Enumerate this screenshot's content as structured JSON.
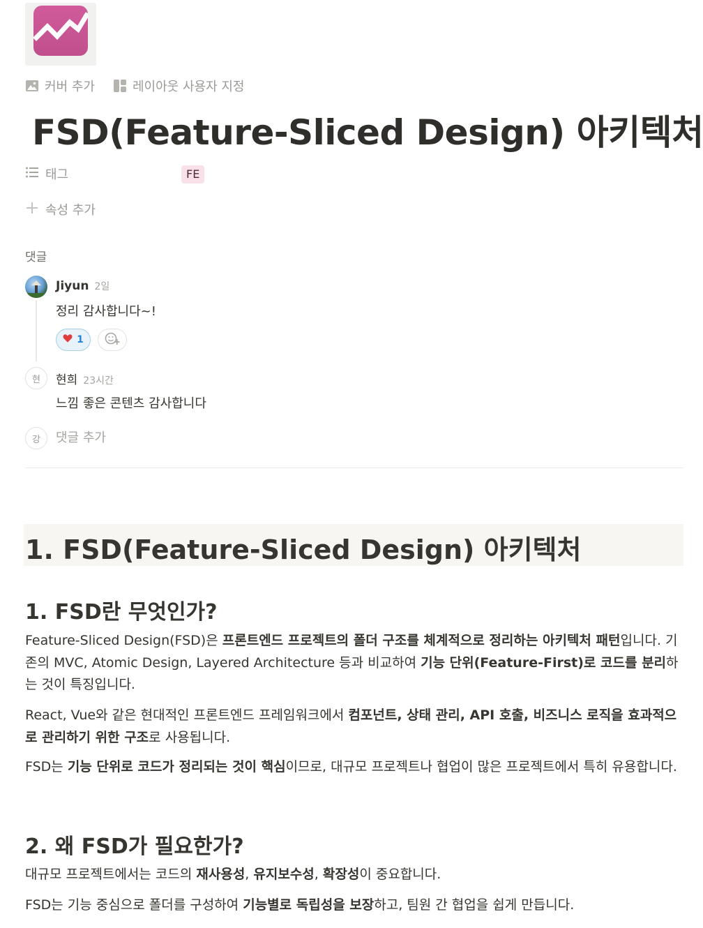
{
  "page": {
    "title": "FSD(Feature-Sliced Design) 아키텍처",
    "icon": "trending-chart-icon",
    "icon_color": "#c9559a"
  },
  "header_actions": {
    "add_cover": "커버 추가",
    "customize_layout": "레이아웃 사용자 지정"
  },
  "properties": {
    "tags_label": "태그",
    "tag_value": "FE",
    "tag_color": "#f9e1ea",
    "add_property": "속성 추가"
  },
  "comments": {
    "label": "댓글",
    "items": [
      {
        "author": "Jiyun",
        "time": "2일",
        "text": "정리 감사합니다~!",
        "reaction_count": "1"
      },
      {
        "avatar_initial": "현",
        "author": "현희",
        "time": "23시간",
        "text": "느낌 좋은 콘텐츠 감사합니다"
      }
    ],
    "composer_avatar": "강",
    "composer_placeholder": "댓글 추가"
  },
  "content": {
    "h1": "1. FSD(Feature-Sliced Design) 아키텍처",
    "section1": {
      "heading": "1. FSD란 무엇인가?",
      "p1": [
        "Feature-Sliced Design(FSD)은 ",
        "프론트엔드 프로젝트의 폴더 구조를 체계적으로 정리하는 아키텍처 패턴",
        "입니다. 기존의 MVC, Atomic Design, Layered Architecture 등과 비교하여 ",
        "기능 단위(Feature-First)로 코드를 분리",
        "하는 것이 특징입니다."
      ],
      "p2": [
        "React, Vue와 같은 현대적인 프론트엔드 프레임워크에서 ",
        "컴포넌트, 상태 관리, API 호출, 비즈니스 로직을 효과적으로 관리하기 위한 구조",
        "로 사용됩니다."
      ],
      "p3": [
        "FSD는 ",
        "기능 단위로 코드가 정리되는 것이 핵심",
        "이므로, 대규모 프로젝트나 협업이 많은 프로젝트에서 특히 유용합니다."
      ]
    },
    "section2": {
      "heading": "2. 왜 FSD가 필요한가?",
      "p1": [
        "대규모 프로젝트에서는 코드의 ",
        "재사용성",
        ", ",
        "유지보수성",
        ", ",
        "확장성",
        "이 중요합니다."
      ],
      "p2": [
        "FSD는 기능 중심으로 폴더를 구성하여 ",
        "기능별로 독립성을 보장",
        "하고, 팀원 간 협업을 쉽게 만듭니다."
      ]
    }
  }
}
